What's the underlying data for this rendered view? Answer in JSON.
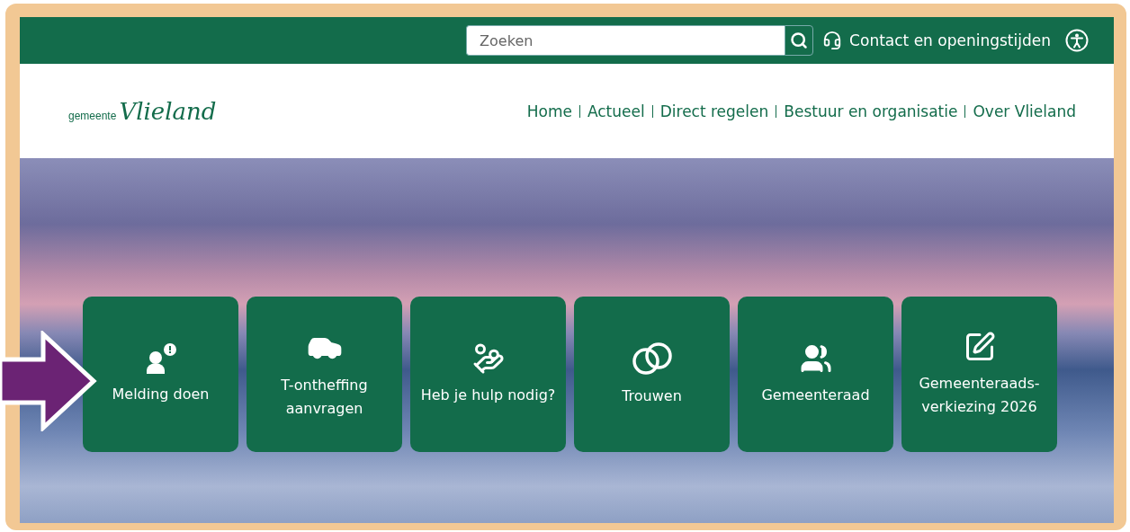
{
  "header": {
    "search": {
      "placeholder": "Zoeken"
    },
    "contact_link": "Contact en openingstijden"
  },
  "logo": {
    "prefix": "gemeente",
    "name": "Vlieland"
  },
  "nav": [
    "Home",
    "Actueel",
    "Direct regelen",
    "Bestuur en organisatie",
    "Over Vlieland"
  ],
  "tiles": [
    {
      "label": "Melding doen"
    },
    {
      "label": "T-ontheffing aanvragen"
    },
    {
      "label": "Heb je hulp nodig?"
    },
    {
      "label": "Trouwen"
    },
    {
      "label": "Gemeenteraad"
    },
    {
      "label": "Gemeenteraads-verkiezing 2026"
    }
  ]
}
